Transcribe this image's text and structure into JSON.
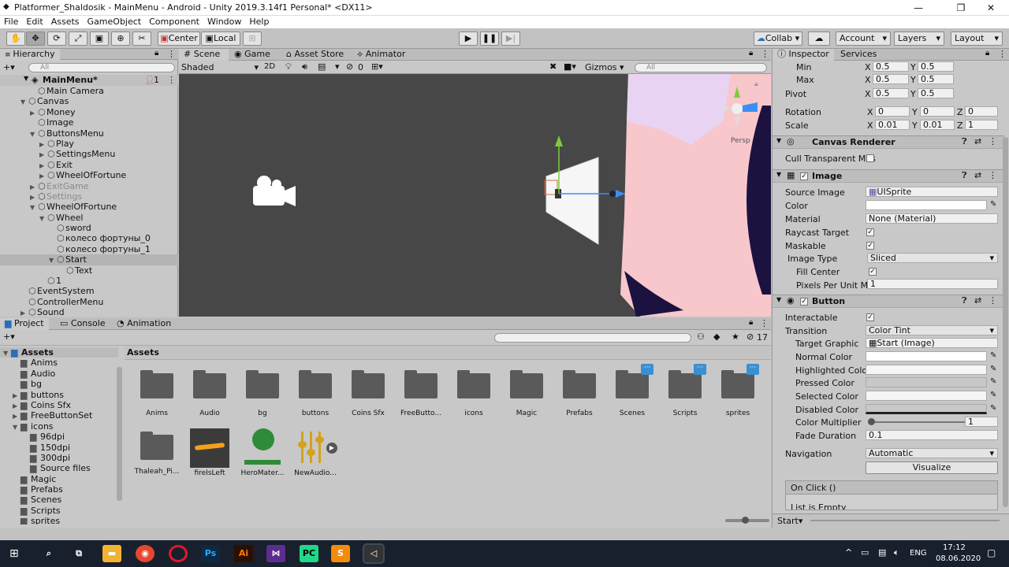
{
  "window": {
    "title": "Platformer_Shaldosik - MainMenu - Android - Unity 2019.3.14f1 Personal* <DX11>"
  },
  "menu": [
    "File",
    "Edit",
    "Assets",
    "GameObject",
    "Component",
    "Window",
    "Help"
  ],
  "toolbar": {
    "center": "Center",
    "local": "Local",
    "collab": "Collab ▾",
    "account": "Account",
    "layers": "Layers",
    "layout": "Layout"
  },
  "hierarchy": {
    "tab": "Hierarchy",
    "search_placeholder": "All",
    "scene": "MainMenu*",
    "count": "1",
    "rows": [
      {
        "label": "Main Camera",
        "indent": 2,
        "arrow": ""
      },
      {
        "label": "Canvas",
        "indent": 1,
        "arrow": "▼"
      },
      {
        "label": "Money",
        "indent": 2,
        "arrow": "▶"
      },
      {
        "label": "Image",
        "indent": 2,
        "arrow": ""
      },
      {
        "label": "ButtonsMenu",
        "indent": 2,
        "arrow": "▼"
      },
      {
        "label": "Play",
        "indent": 3,
        "arrow": "▶"
      },
      {
        "label": "SettingsMenu",
        "indent": 3,
        "arrow": "▶"
      },
      {
        "label": "Exit",
        "indent": 3,
        "arrow": "▶"
      },
      {
        "label": "WheelOfFortune",
        "indent": 3,
        "arrow": "▶"
      },
      {
        "label": "ExitGame",
        "indent": 2,
        "arrow": "▶",
        "dim": true
      },
      {
        "label": "Settings",
        "indent": 2,
        "arrow": "▶",
        "dim": true
      },
      {
        "label": "WheelOfFortune",
        "indent": 2,
        "arrow": "▼"
      },
      {
        "label": "Wheel",
        "indent": 3,
        "arrow": "▼"
      },
      {
        "label": "sword",
        "indent": 4,
        "arrow": ""
      },
      {
        "label": "колесо фортуны_0",
        "indent": 4,
        "arrow": ""
      },
      {
        "label": "колесо фортуны_1",
        "indent": 4,
        "arrow": ""
      },
      {
        "label": "Start",
        "indent": 4,
        "arrow": "▼",
        "selected": true
      },
      {
        "label": "Text",
        "indent": 5,
        "arrow": ""
      },
      {
        "label": "1",
        "indent": 3,
        "arrow": ""
      },
      {
        "label": "EventSystem",
        "indent": 1,
        "arrow": ""
      },
      {
        "label": "ControllerMenu",
        "indent": 1,
        "arrow": ""
      },
      {
        "label": "Sound",
        "indent": 1,
        "arrow": "▶"
      }
    ]
  },
  "scene": {
    "tabs": [
      "Scene",
      "Game",
      "Asset Store",
      "Animator"
    ],
    "shading": "Shaded",
    "mode2d": "2D",
    "hidden_count": "0",
    "gizmos": "Gizmos",
    "search_placeholder": "All",
    "persp": "Persp"
  },
  "project": {
    "tabs": [
      "Project",
      "Console",
      "Animation"
    ],
    "hidden_count": "17",
    "tree": [
      {
        "label": "Assets",
        "indent": 0,
        "arrow": "▼",
        "bold": true
      },
      {
        "label": "Anims",
        "indent": 1,
        "arrow": ""
      },
      {
        "label": "Audio",
        "indent": 1,
        "arrow": ""
      },
      {
        "label": "bg",
        "indent": 1,
        "arrow": ""
      },
      {
        "label": "buttons",
        "indent": 1,
        "arrow": "▶"
      },
      {
        "label": "Coins Sfx",
        "indent": 1,
        "arrow": "▶"
      },
      {
        "label": "FreeButtonSet",
        "indent": 1,
        "arrow": "▶"
      },
      {
        "label": "icons",
        "indent": 1,
        "arrow": "▼"
      },
      {
        "label": "96dpi",
        "indent": 2,
        "arrow": ""
      },
      {
        "label": "150dpi",
        "indent": 2,
        "arrow": ""
      },
      {
        "label": "300dpi",
        "indent": 2,
        "arrow": ""
      },
      {
        "label": "Source files",
        "indent": 2,
        "arrow": ""
      },
      {
        "label": "Magic",
        "indent": 1,
        "arrow": ""
      },
      {
        "label": "Prefabs",
        "indent": 1,
        "arrow": ""
      },
      {
        "label": "Scenes",
        "indent": 1,
        "arrow": ""
      },
      {
        "label": "Scripts",
        "indent": 1,
        "arrow": ""
      },
      {
        "label": "sprites",
        "indent": 1,
        "arrow": ""
      }
    ],
    "breadcrumb": "Assets",
    "items_row1": [
      {
        "label": "Anims",
        "badge": false
      },
      {
        "label": "Audio",
        "badge": false
      },
      {
        "label": "bg",
        "badge": false
      },
      {
        "label": "buttons",
        "badge": false
      },
      {
        "label": "Coins Sfx",
        "badge": false
      },
      {
        "label": "FreeButto...",
        "badge": false
      },
      {
        "label": "icons",
        "badge": false
      },
      {
        "label": "Magic",
        "badge": false
      },
      {
        "label": "Prefabs",
        "badge": false
      },
      {
        "label": "Scenes",
        "badge": true
      },
      {
        "label": "Scripts",
        "badge": true
      },
      {
        "label": "sprites",
        "badge": true
      }
    ],
    "items_row2": [
      "Thaleah_Pi...",
      "fireIsLeft",
      "HeroMater...",
      "NewAudio..."
    ]
  },
  "inspector": {
    "tabs": [
      "Inspector",
      "Services"
    ],
    "anchors": {
      "min_label": "Min",
      "min_x": "0.5",
      "min_y": "0.5",
      "max_label": "Max",
      "max_x": "0.5",
      "max_y": "0.5",
      "pivot_label": "Pivot",
      "pivot_x": "0.5",
      "pivot_y": "0.5",
      "rotation_label": "Rotation",
      "rot_x": "0",
      "rot_y": "0",
      "rot_z": "0",
      "scale_label": "Scale",
      "scale_x": "0.01",
      "scale_y": "0.01",
      "scale_z": "1"
    },
    "canvas_renderer": {
      "title": "Canvas Renderer",
      "cull": "Cull Transparent Mes"
    },
    "image": {
      "title": "Image",
      "source_label": "Source Image",
      "source_value": "UISprite",
      "color_label": "Color",
      "material_label": "Material",
      "material_value": "None (Material)",
      "raycast_label": "Raycast Target",
      "maskable_label": "Maskable",
      "type_label": "Image Type",
      "type_value": "Sliced",
      "fill_label": "Fill Center",
      "ppu_label": "Pixels Per Unit Mul",
      "ppu_value": "1"
    },
    "button": {
      "title": "Button",
      "interactable_label": "Interactable",
      "transition_label": "Transition",
      "transition_value": "Color Tint",
      "target_label": "Target Graphic",
      "target_value": "Start (Image)",
      "normal_label": "Normal Color",
      "highlighted_label": "Highlighted Color",
      "pressed_label": "Pressed Color",
      "selected_label": "Selected Color",
      "disabled_label": "Disabled Color",
      "multiplier_label": "Color Multiplier",
      "multiplier_value": "1",
      "fade_label": "Fade Duration",
      "fade_value": "0.1",
      "nav_label": "Navigation",
      "nav_value": "Automatic",
      "visualize": "Visualize",
      "onclick": "On Click ()",
      "list_empty": "List is Empty"
    },
    "footer": "Start"
  },
  "taskbar": {
    "time": "17:12",
    "date": "08.06.2020",
    "lang": "ENG"
  }
}
